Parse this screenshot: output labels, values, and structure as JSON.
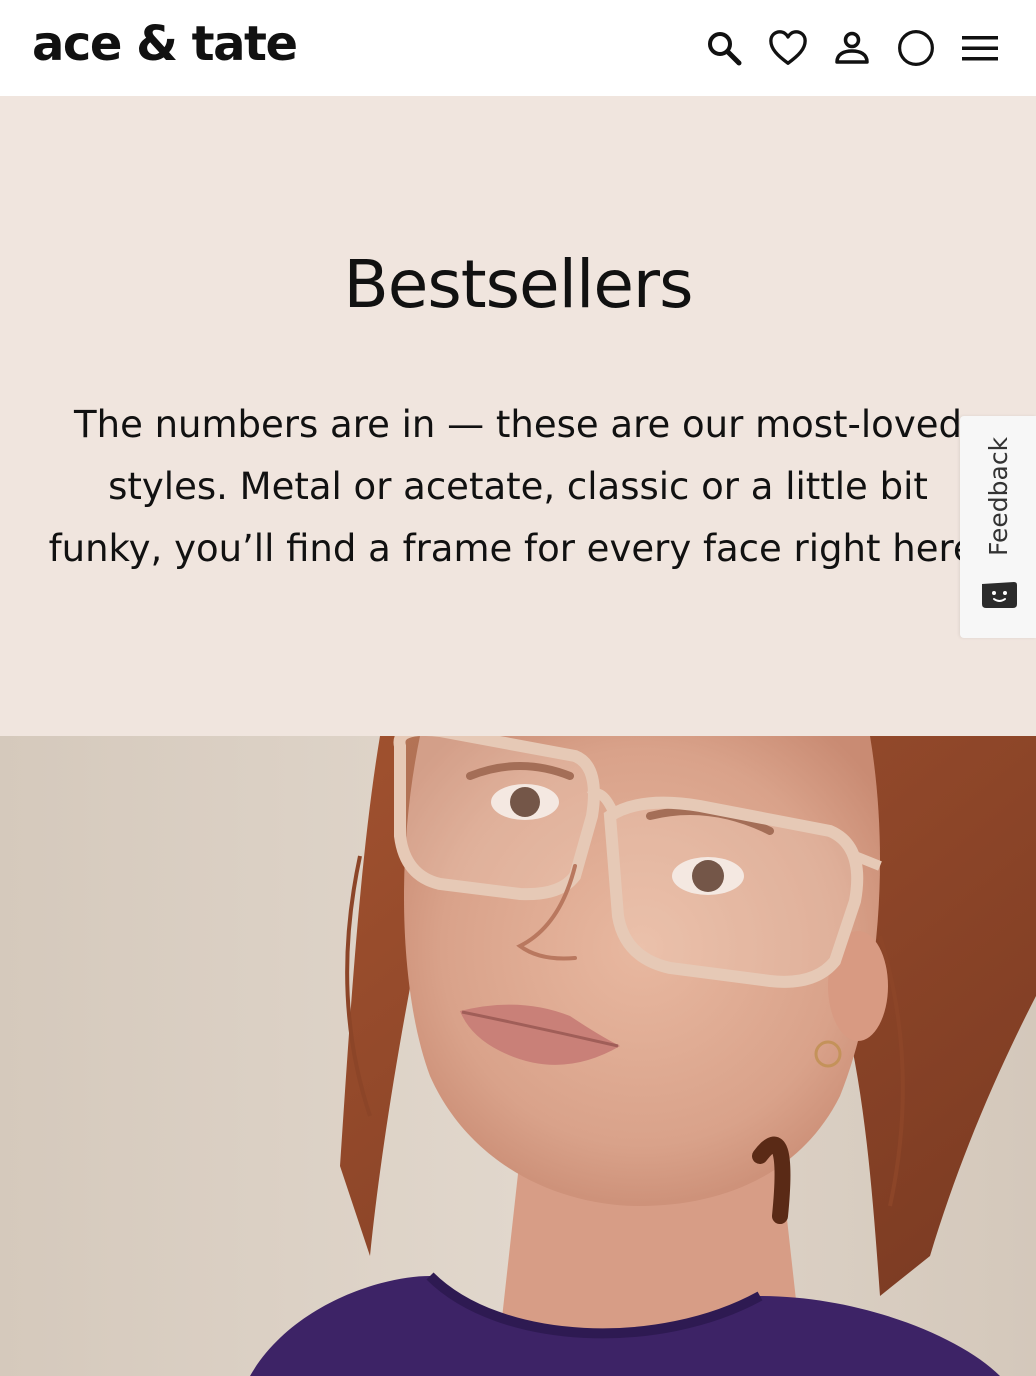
{
  "header": {
    "logo": "ace & tate",
    "icons": [
      "search-icon",
      "heart-icon",
      "user-icon",
      "cart-circle-icon",
      "menu-icon"
    ]
  },
  "hero": {
    "title": "Bestsellers",
    "description": "The numbers are in — these are our most-loved styles. Metal or acetate, classic or a little bit funky, you’ll find a frame for every face right here."
  },
  "feedback": {
    "label": "Feedback"
  },
  "colors": {
    "hero_background": "#f0e5de",
    "header_background": "#ffffff",
    "text": "#111111",
    "sweater": "#3d2366"
  }
}
